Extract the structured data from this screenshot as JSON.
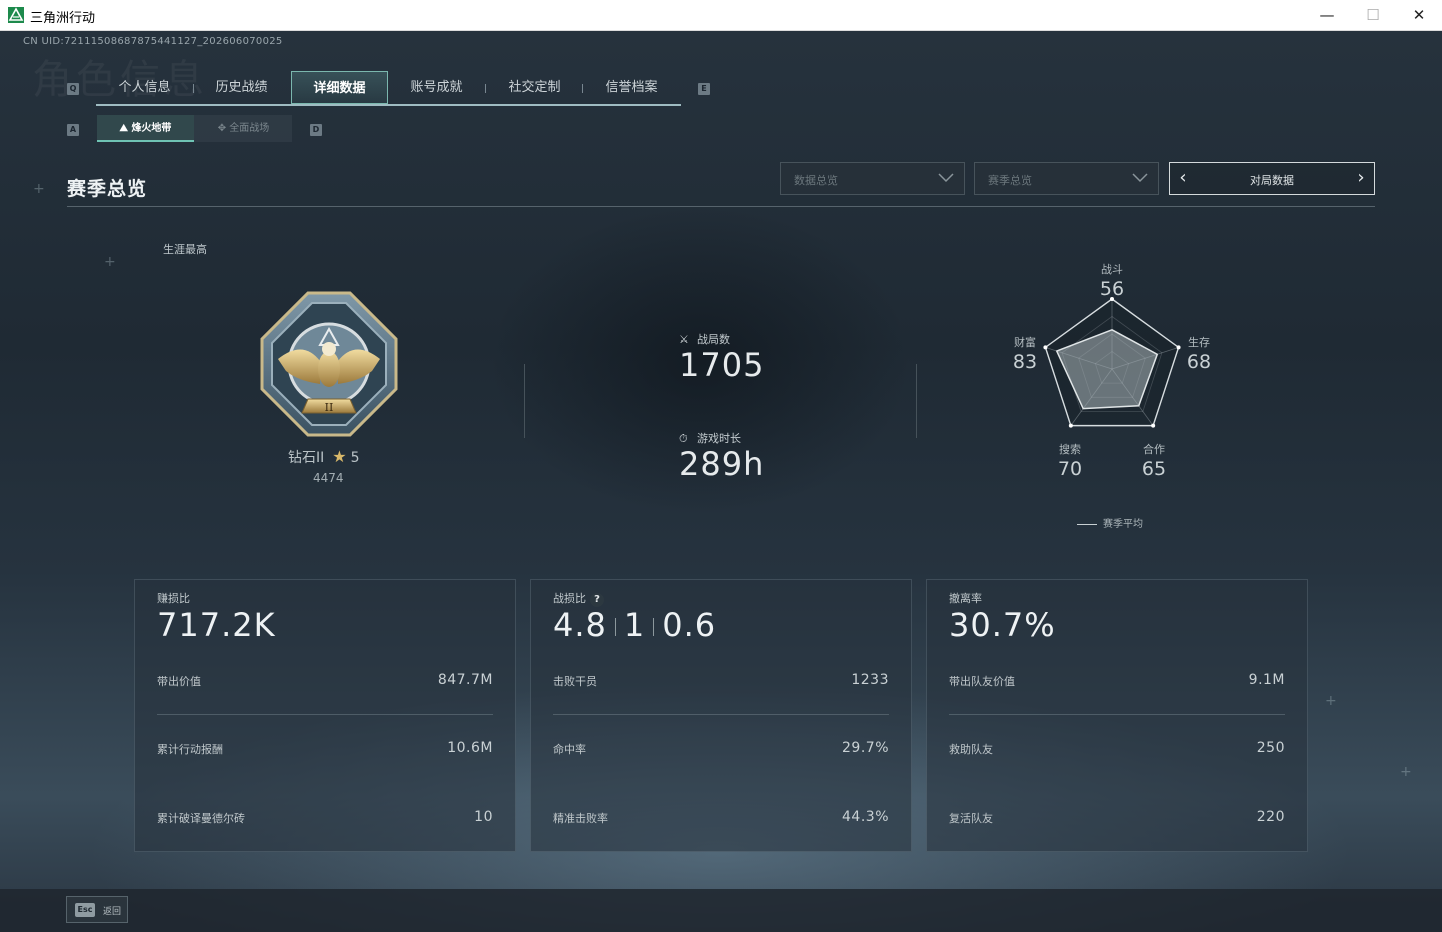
{
  "window": {
    "title": "三角洲行动",
    "minimize": "—",
    "maximize": "☐",
    "close": "✕"
  },
  "header": {
    "uid": "CN UID:72111508687875441127_202606070025",
    "watermark": "角色信息"
  },
  "tabs": {
    "left_key": "Q",
    "right_key": "E",
    "items": [
      {
        "label": "个人信息",
        "active": false
      },
      {
        "label": "历史战绩",
        "active": false
      },
      {
        "label": "详细数据",
        "active": true
      },
      {
        "label": "账号成就",
        "active": false
      },
      {
        "label": "社交定制",
        "active": false
      },
      {
        "label": "信誉档案",
        "active": false
      }
    ]
  },
  "subtabs": {
    "left_key": "A",
    "right_key": "D",
    "items": [
      {
        "icon": "⛰",
        "label": "烽火地带",
        "active": true
      },
      {
        "icon": "✥",
        "label": "全面战场",
        "active": false
      }
    ]
  },
  "section": {
    "title": "赛季总览"
  },
  "filters": {
    "dropdown1": "数据总览",
    "dropdown2": "赛季总览",
    "pager_label": "对局数据",
    "prev": "‹",
    "next": "›"
  },
  "rank": {
    "career_label": "生涯最高",
    "name": "钻石II",
    "star_icon": "★",
    "stars": "5",
    "score": "4474",
    "badge_numeral": "II"
  },
  "summary": {
    "matches_icon": "⚔",
    "matches_label": "战局数",
    "matches_value": "1705",
    "time_icon": "⏱",
    "time_label": "游戏时长",
    "time_value": "289h"
  },
  "radar": {
    "axes": [
      {
        "label": "战斗",
        "value": "56"
      },
      {
        "label": "生存",
        "value": "68"
      },
      {
        "label": "合作",
        "value": "65"
      },
      {
        "label": "搜索",
        "value": "70"
      },
      {
        "label": "财富",
        "value": "83"
      }
    ],
    "legend": "赛季平均"
  },
  "cards": [
    {
      "label": "赚损比",
      "main": "717.2K",
      "rows": [
        {
          "label": "带出价值",
          "value": "847.7M"
        },
        {
          "label": "累计行动报酬",
          "value": "10.6M"
        },
        {
          "label": "累计破译曼德尔砖",
          "value": "10"
        }
      ]
    },
    {
      "label": "战损比",
      "help": "?",
      "kd": [
        "4.8",
        "1",
        "0.6"
      ],
      "rows": [
        {
          "label": "击败干员",
          "value": "1233"
        },
        {
          "label": "命中率",
          "value": "29.7%"
        },
        {
          "label": "精准击败率",
          "value": "44.3%"
        }
      ]
    },
    {
      "label": "撤离率",
      "main": "30.7%",
      "rows": [
        {
          "label": "带出队友价值",
          "value": "9.1M"
        },
        {
          "label": "救助队友",
          "value": "250"
        },
        {
          "label": "复活队友",
          "value": "220"
        }
      ]
    }
  ],
  "footer": {
    "esc_key": "Esc",
    "back_label": "返回"
  },
  "colors": {
    "accent": "#6fc3b4",
    "tab_underline": "#9fbcc2",
    "star": "#d8b86a"
  }
}
